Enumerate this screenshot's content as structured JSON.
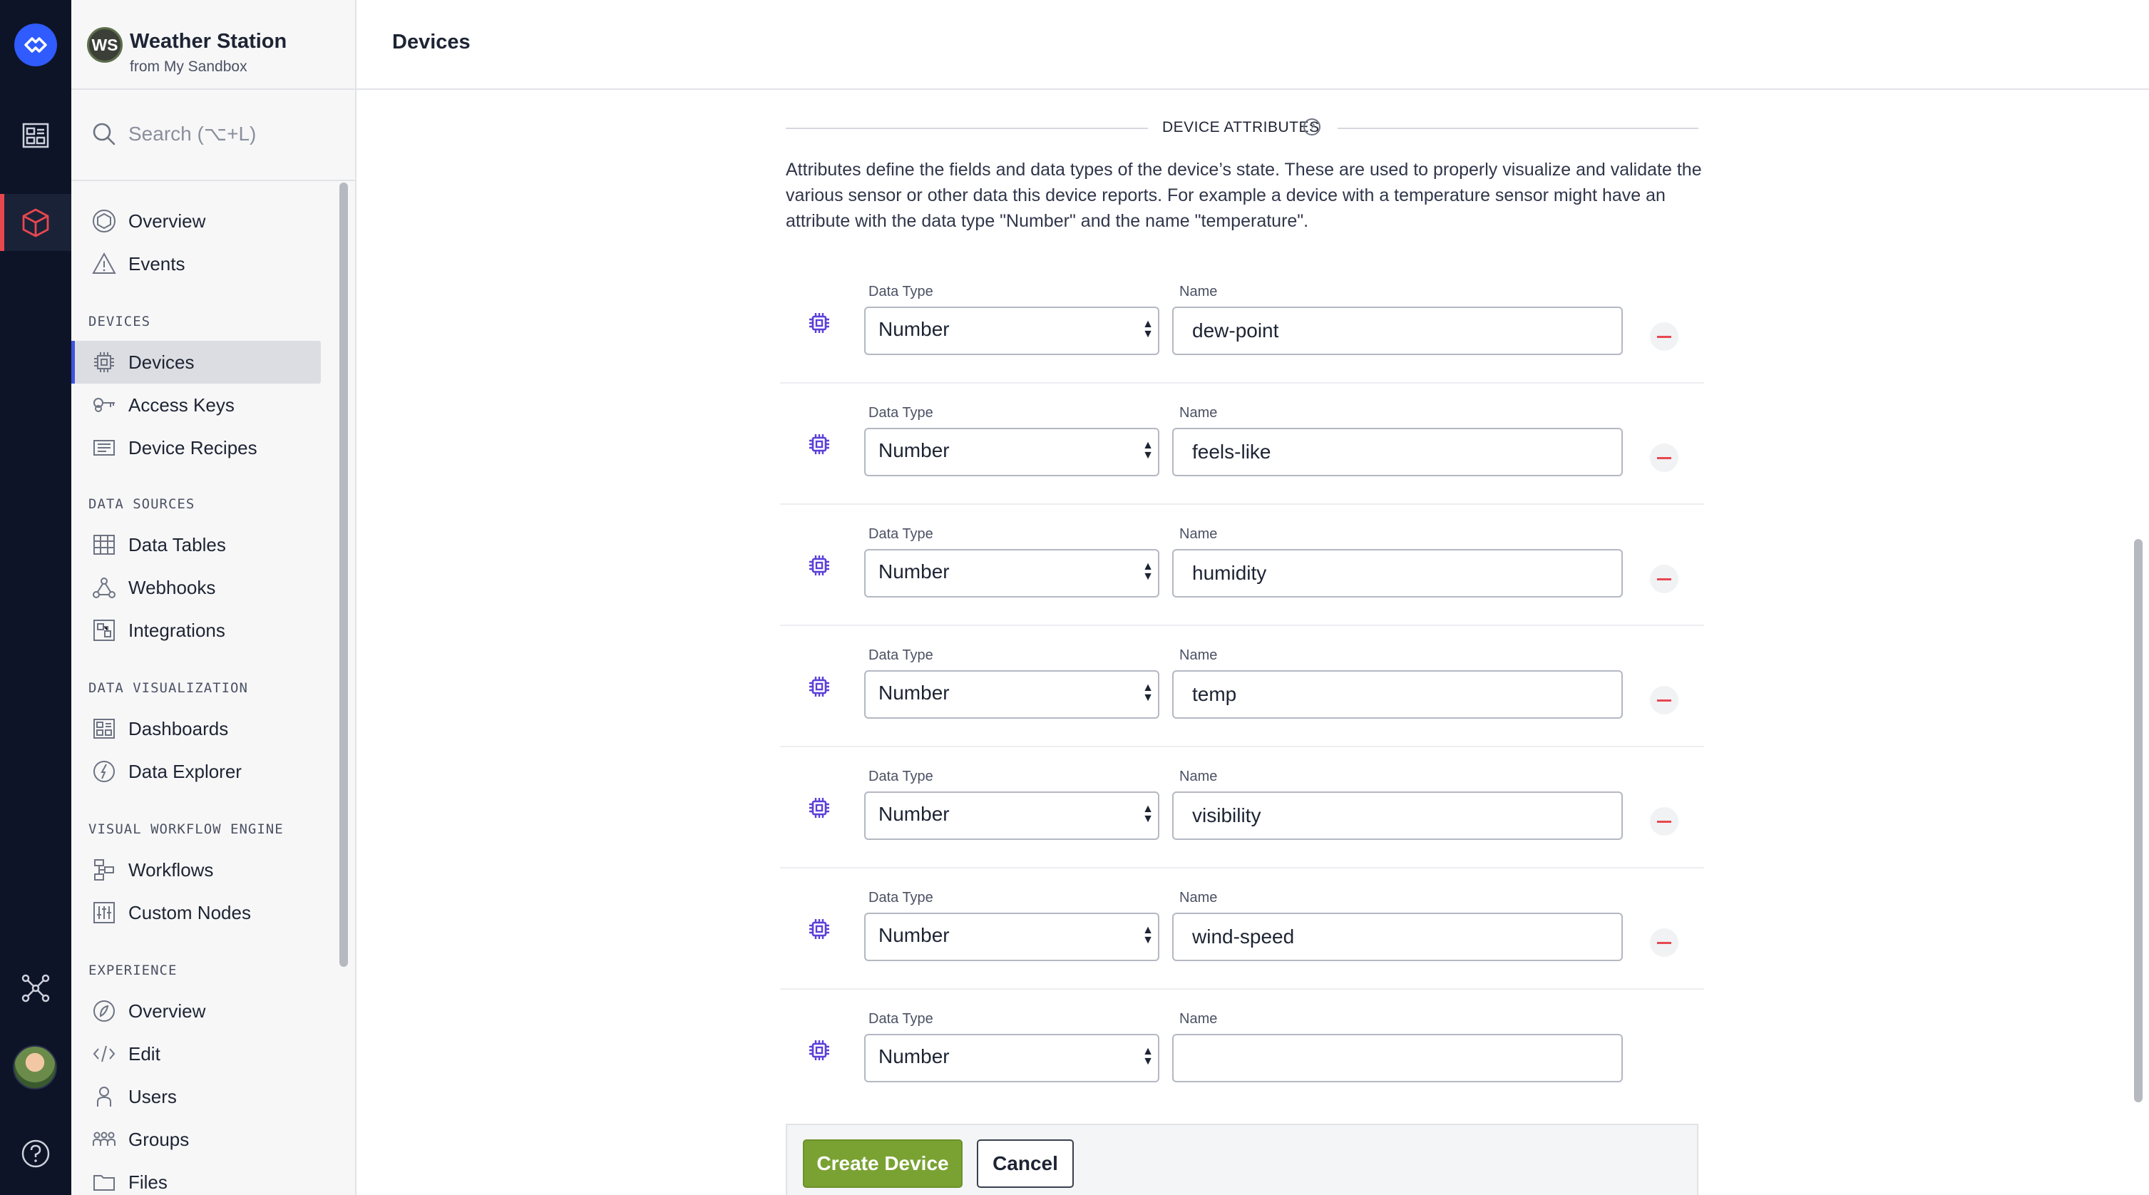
{
  "app": {
    "badge": "WS",
    "name": "Weather Station",
    "subtitle": "from My Sandbox"
  },
  "search": {
    "placeholder": "Search (⌥+L)"
  },
  "nav": {
    "top_items": [
      {
        "label": "Overview",
        "icon": "overview-icon"
      },
      {
        "label": "Events",
        "icon": "warning-triangle-icon"
      }
    ],
    "sections": [
      {
        "heading": "DEVICES",
        "items": [
          {
            "label": "Devices",
            "icon": "chip-icon",
            "active": true
          },
          {
            "label": "Access Keys",
            "icon": "key-icon"
          },
          {
            "label": "Device Recipes",
            "icon": "recipe-icon"
          }
        ]
      },
      {
        "heading": "DATA SOURCES",
        "items": [
          {
            "label": "Data Tables",
            "icon": "table-icon"
          },
          {
            "label": "Webhooks",
            "icon": "webhook-icon"
          },
          {
            "label": "Integrations",
            "icon": "integrations-icon"
          }
        ]
      },
      {
        "heading": "DATA VISUALIZATION",
        "items": [
          {
            "label": "Dashboards",
            "icon": "dashboard-icon"
          },
          {
            "label": "Data Explorer",
            "icon": "compass-icon"
          }
        ]
      },
      {
        "heading": "VISUAL WORKFLOW ENGINE",
        "items": [
          {
            "label": "Workflows",
            "icon": "workflow-icon"
          },
          {
            "label": "Custom Nodes",
            "icon": "sliders-icon"
          }
        ]
      },
      {
        "heading": "EXPERIENCE",
        "items": [
          {
            "label": "Overview",
            "icon": "experience-icon"
          },
          {
            "label": "Edit",
            "icon": "code-icon"
          },
          {
            "label": "Users",
            "icon": "user-icon"
          },
          {
            "label": "Groups",
            "icon": "groups-icon"
          },
          {
            "label": "Files",
            "icon": "folder-icon"
          }
        ]
      }
    ]
  },
  "header": {
    "title": "Devices"
  },
  "attributes_section": {
    "heading": "DEVICE ATTRIBUTES",
    "help_icon": "question-circle-icon",
    "description": "Attributes define the fields and data types of the device’s state. These are used to properly visualize and validate the various sensor or other data this device reports. For example a device with a temperature sensor might have an attribute with the data type \"Number\" and the name \"temperature\".",
    "data_type_label": "Data Type",
    "name_label": "Name",
    "rows": [
      {
        "data_type": "Number",
        "name": "dew-point",
        "removable": true
      },
      {
        "data_type": "Number",
        "name": "feels-like",
        "removable": true
      },
      {
        "data_type": "Number",
        "name": "humidity",
        "removable": true
      },
      {
        "data_type": "Number",
        "name": "temp",
        "removable": true
      },
      {
        "data_type": "Number",
        "name": "visibility",
        "removable": true
      },
      {
        "data_type": "Number",
        "name": "wind-speed",
        "removable": true
      },
      {
        "data_type": "Number",
        "name": "",
        "removable": false
      }
    ]
  },
  "actions": {
    "create_label": "Create Device",
    "cancel_label": "Cancel"
  },
  "colors": {
    "rail_bg": "#0e1427",
    "accent_blue": "#3d54e0",
    "create_green": "#7aa233",
    "remove_red": "#e8474f",
    "chip_purple": "#5b3fd9"
  }
}
